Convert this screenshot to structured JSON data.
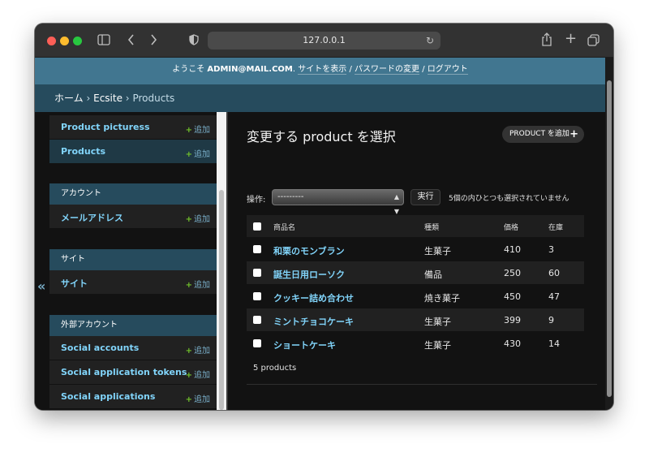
{
  "browser": {
    "url": "127.0.0.1"
  },
  "userbar": {
    "welcome": "ようこそ",
    "user": "ADMIN@MAIL.COM",
    "view_site": "サイトを表示",
    "change_password": "パスワードの変更",
    "logout": "ログアウト",
    "separator": "/"
  },
  "breadcrumbs": [
    "ホーム",
    "Ecsite",
    "Products"
  ],
  "breadcrumb_sep": "›",
  "sidebar": {
    "toggle": "«",
    "add_label": "追加",
    "apps": [
      {
        "header": "",
        "models": [
          {
            "name": "Product picturess"
          },
          {
            "name": "Products",
            "current": true
          }
        ]
      },
      {
        "header": "アカウント",
        "models": [
          {
            "name": "メールアドレス"
          }
        ]
      },
      {
        "header": "サイト",
        "models": [
          {
            "name": "サイト"
          }
        ]
      },
      {
        "header": "外部アカウント",
        "models": [
          {
            "name": "Social accounts"
          },
          {
            "name": "Social application tokens"
          },
          {
            "name": "Social applications"
          }
        ]
      }
    ]
  },
  "main": {
    "title": "変更する product を選択",
    "add_button": "PRODUCT を追加",
    "actions": {
      "label": "操作:",
      "select_value": "---------",
      "go": "実行",
      "counter": "5個の内ひとつも選択されていません"
    },
    "table": {
      "headers": [
        "商品名",
        "種類",
        "価格",
        "在庫"
      ],
      "rows": [
        {
          "name": "和栗のモンブラン",
          "type": "生菓子",
          "price": "410",
          "stock": "3"
        },
        {
          "name": "誕生日用ローソク",
          "type": "備品",
          "price": "250",
          "stock": "60"
        },
        {
          "name": "クッキー詰め合わせ",
          "type": "焼き菓子",
          "price": "450",
          "stock": "47"
        },
        {
          "name": "ミントチョコケーキ",
          "type": "生菓子",
          "price": "399",
          "stock": "9"
        },
        {
          "name": "ショートケーキ",
          "type": "生菓子",
          "price": "430",
          "stock": "14"
        }
      ]
    },
    "paginator": "5 products"
  },
  "colors": {
    "header_blue": "#417690",
    "breadcrumb_blue": "#264b5d",
    "link": "#81d4fa",
    "add_green": "#70bf2b"
  }
}
